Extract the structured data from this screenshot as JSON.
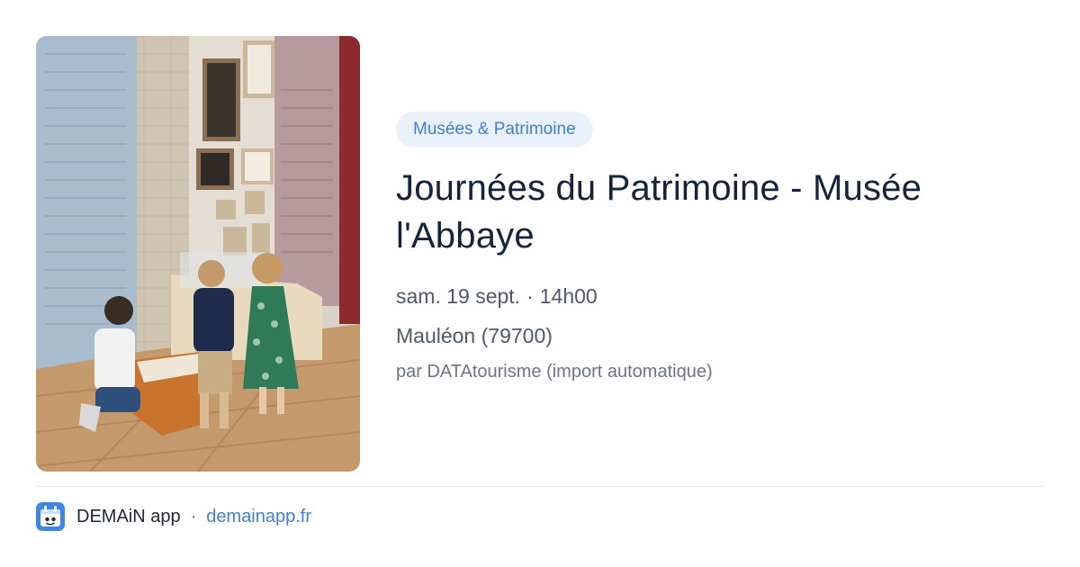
{
  "photo": {
    "subject": "children looking at a museum display case in front of framed pictures"
  },
  "event": {
    "category": "Musées & Patrimoine",
    "title": "Journées du Patrimoine - Musée l'Abbaye",
    "date": "sam. 19 sept.",
    "separator": "·",
    "time": "14h00",
    "location": "Mauléon (79700)",
    "author": "par DATAtourisme (import automatique)"
  },
  "footer": {
    "app_name": "DEMAiN app",
    "separator": "·",
    "url": "demainapp.fr",
    "icon": "calendar-icon"
  },
  "colors": {
    "accent": "#3f7fd6",
    "tag_bg": "#eaf1fb",
    "title": "#15233b"
  }
}
